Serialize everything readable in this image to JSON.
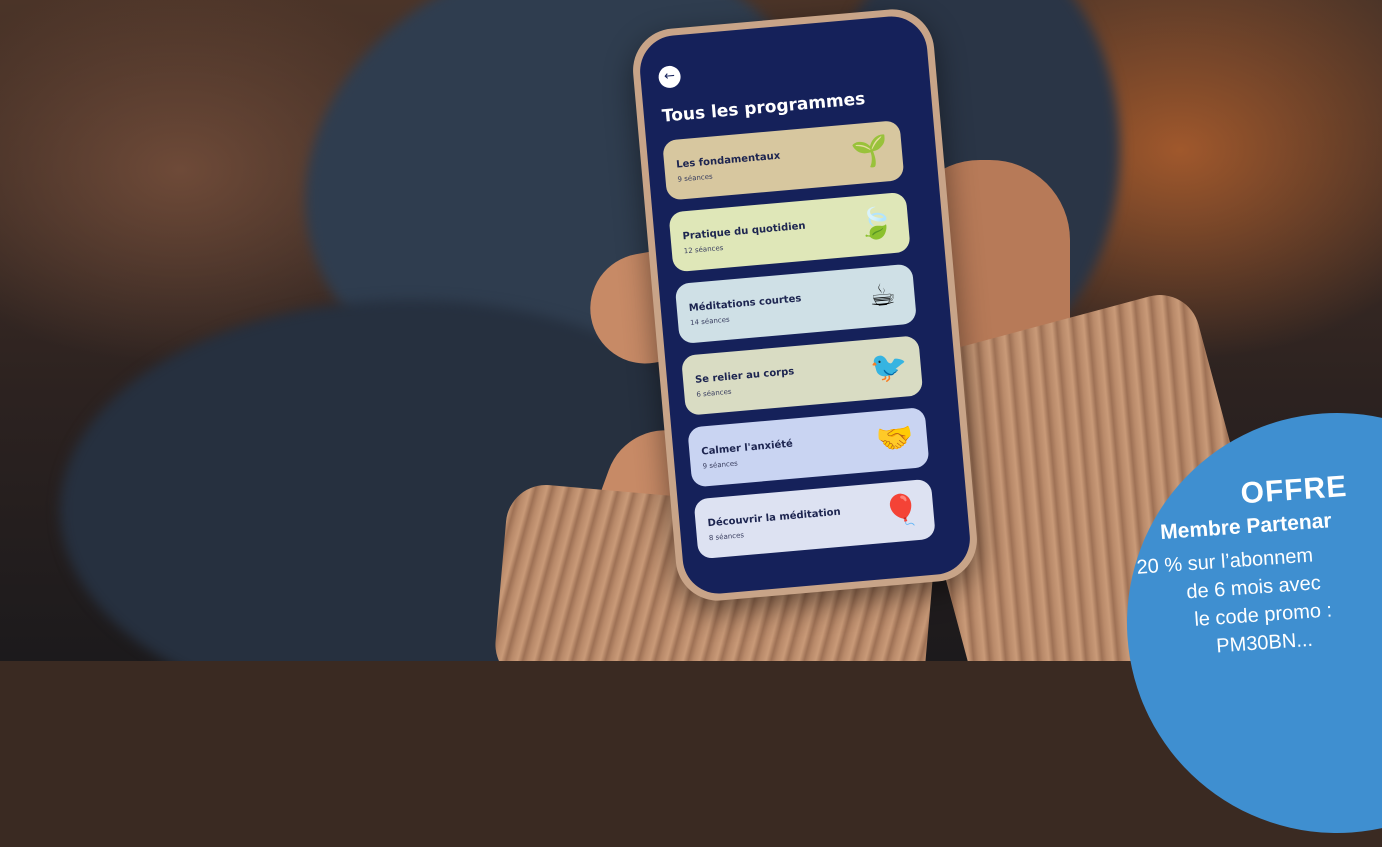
{
  "app": {
    "title": "Tous les programmes",
    "back_icon": "arrow-left-icon"
  },
  "programs": [
    {
      "name": "Les fondamentaux",
      "count": "9 séances",
      "color": "#d7c79f",
      "icon": "tree-stump-icon",
      "glyph": "🌱"
    },
    {
      "name": "Pratique du quotidien",
      "count": "12 séances",
      "color": "#dfe7b8",
      "icon": "leaf-stones-icon",
      "glyph": "🍃"
    },
    {
      "name": "Méditations courtes",
      "count": "14 séances",
      "color": "#cfe0e6",
      "icon": "coffee-cup-icon",
      "glyph": "☕"
    },
    {
      "name": "Se relier au corps",
      "count": "6 séances",
      "color": "#d9dcc3",
      "icon": "bird-icon",
      "glyph": "🐦"
    },
    {
      "name": "Calmer l'anxiété",
      "count": "9 séances",
      "color": "#c9d4f2",
      "icon": "holding-hands-icon",
      "glyph": "🤝"
    },
    {
      "name": "Découvrir la méditation",
      "count": "8 séances",
      "color": "#dde2f2",
      "icon": "hot-air-balloon-icon",
      "glyph": "🎈"
    }
  ],
  "offer": {
    "title": "OFFRE",
    "subtitle": "Membre Partenar",
    "lines": [
      "20 % sur l’abonnem",
      "de 6 mois avec",
      "le code promo :",
      "PM30BN..."
    ]
  }
}
